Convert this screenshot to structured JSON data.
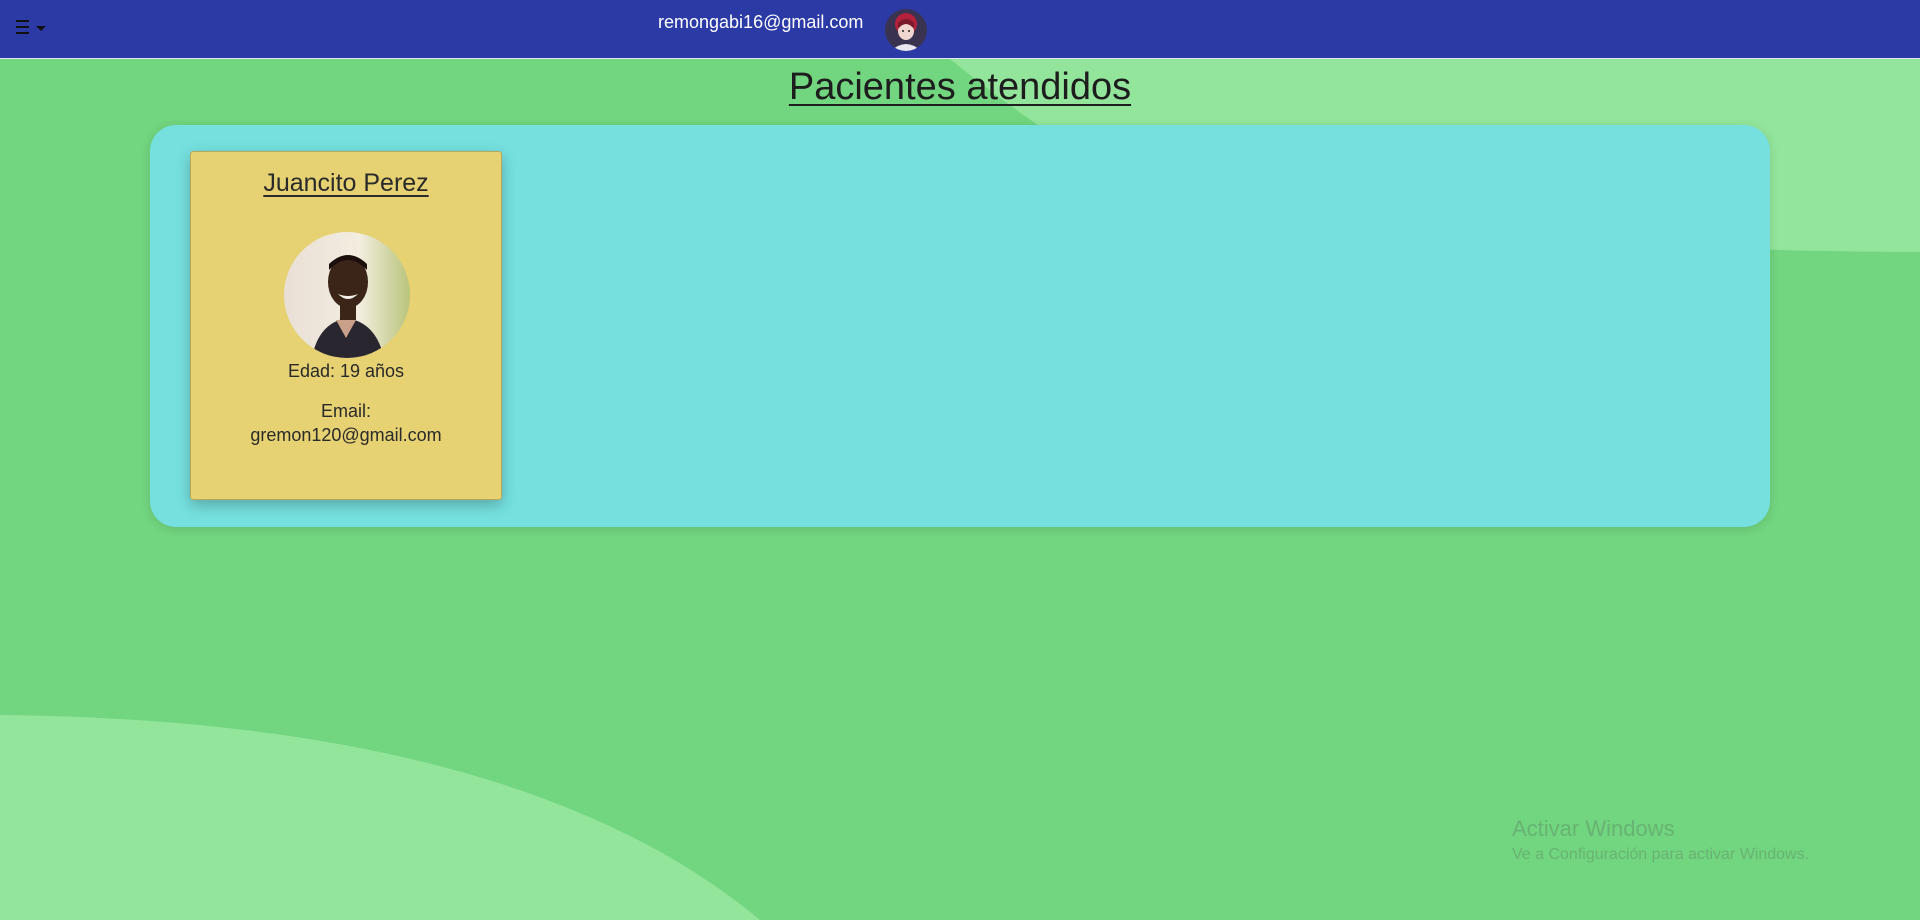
{
  "header": {
    "menu_icon": "menu-lines-dropdown-icon",
    "user_email": "remongabi16@gmail.com",
    "avatar_icon": "user-avatar-photo"
  },
  "page": {
    "title": "Pacientes atendidos"
  },
  "patients": [
    {
      "name": "Juancito Perez",
      "photo_icon": "patient-avatar-photo",
      "age_text": "Edad: 19 años",
      "email_label": "Email:",
      "email": "gremon120@gmail.com"
    }
  ],
  "watermark": {
    "title": "Activar Windows",
    "subtitle": "Ve a Configuración para activar Windows."
  },
  "colors": {
    "topbar": "#2b3aa5",
    "background": "#72d57f",
    "background_light": "#93e59c",
    "panel": "#75e0de",
    "card": "#e6d173"
  }
}
